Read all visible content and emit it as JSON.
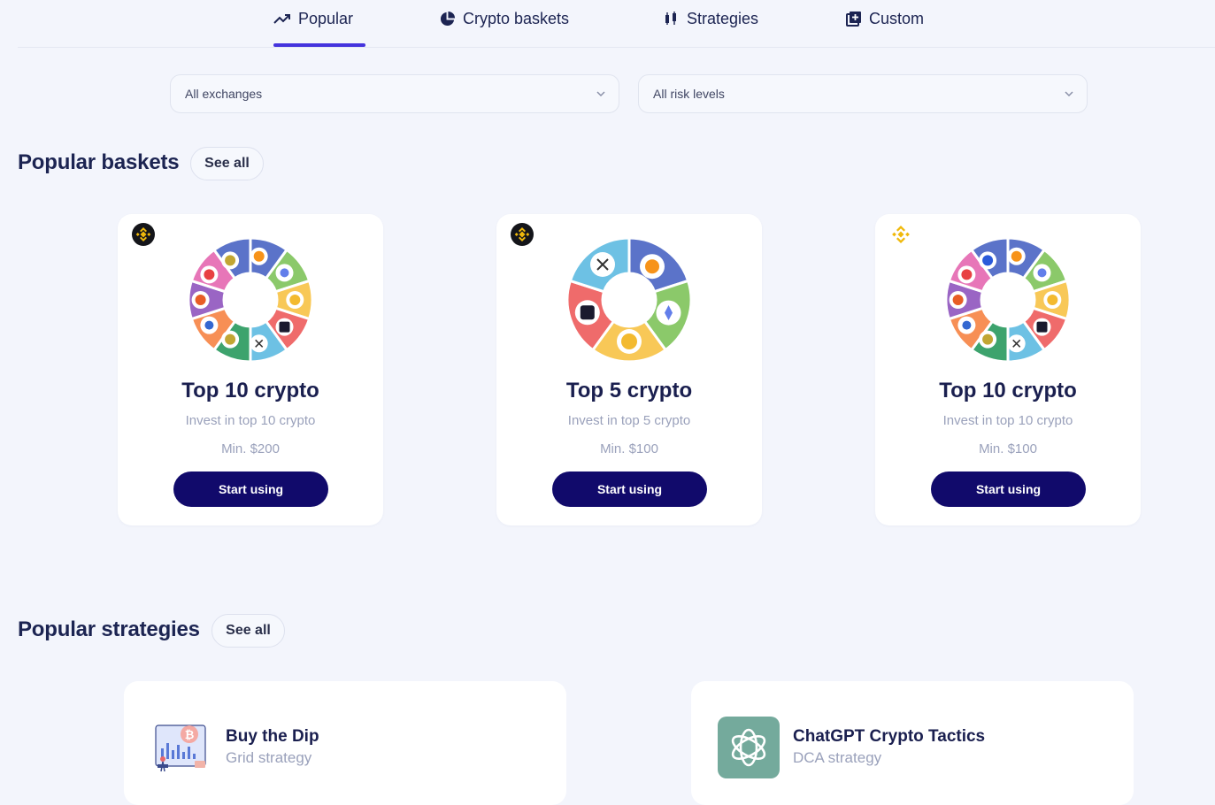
{
  "tabs": [
    {
      "label": "Popular",
      "icon": "trending-up-icon",
      "active": true
    },
    {
      "label": "Crypto baskets",
      "icon": "pie-chart-icon",
      "active": false
    },
    {
      "label": "Strategies",
      "icon": "candles-icon",
      "active": false
    },
    {
      "label": "Custom",
      "icon": "add-box-icon",
      "active": false
    }
  ],
  "filters": {
    "exchange": "All exchanges",
    "risk": "All risk levels"
  },
  "baskets_section": {
    "title": "Popular baskets",
    "see_all": "See all"
  },
  "baskets": [
    {
      "exchange_icon": "binance-icon",
      "title": "Top 10 crypto",
      "subtitle": "Invest in top 10 crypto",
      "min": "Min. $200",
      "button": "Start using"
    },
    {
      "exchange_icon": "binance-icon",
      "title": "Top 5 crypto",
      "subtitle": "Invest in top 5 crypto",
      "min": "Min. $100",
      "button": "Start using"
    },
    {
      "exchange_icon": "binance-icon",
      "title": "Top 10 crypto",
      "subtitle": "Invest in top 10 crypto",
      "min": "Min. $100",
      "button": "Start using"
    }
  ],
  "strategies_section": {
    "title": "Popular strategies",
    "see_all": "See all"
  },
  "strategies": [
    {
      "icon": "bitcoin-chart-illustration-icon",
      "title": "Buy the Dip",
      "subtitle": "Grid strategy"
    },
    {
      "icon": "chatgpt-logo-icon",
      "title": "ChatGPT Crypto Tactics",
      "subtitle": "DCA strategy"
    }
  ],
  "colors": {
    "accent": "#4433dd",
    "button": "#110a6b",
    "background": "#f3f5fc"
  }
}
